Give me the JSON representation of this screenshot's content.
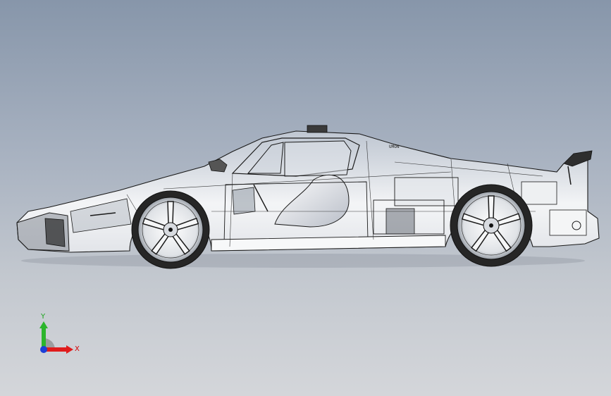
{
  "viewport": {
    "background_top": "#8796aa",
    "background_bottom": "#d4d6da"
  },
  "model": {
    "icon": "car-wireframe-icon",
    "wire_color": "#1a1a1a",
    "body_fill": "#f2f3f5",
    "tire_color": "#262626",
    "rim_fill": "#e9eaec",
    "badge_text": "UMON"
  },
  "triad": {
    "x_label": "X",
    "y_label": "Y",
    "x_color": "#e01c1c",
    "y_color": "#2cb52c",
    "z_color": "#1c3fd8"
  }
}
